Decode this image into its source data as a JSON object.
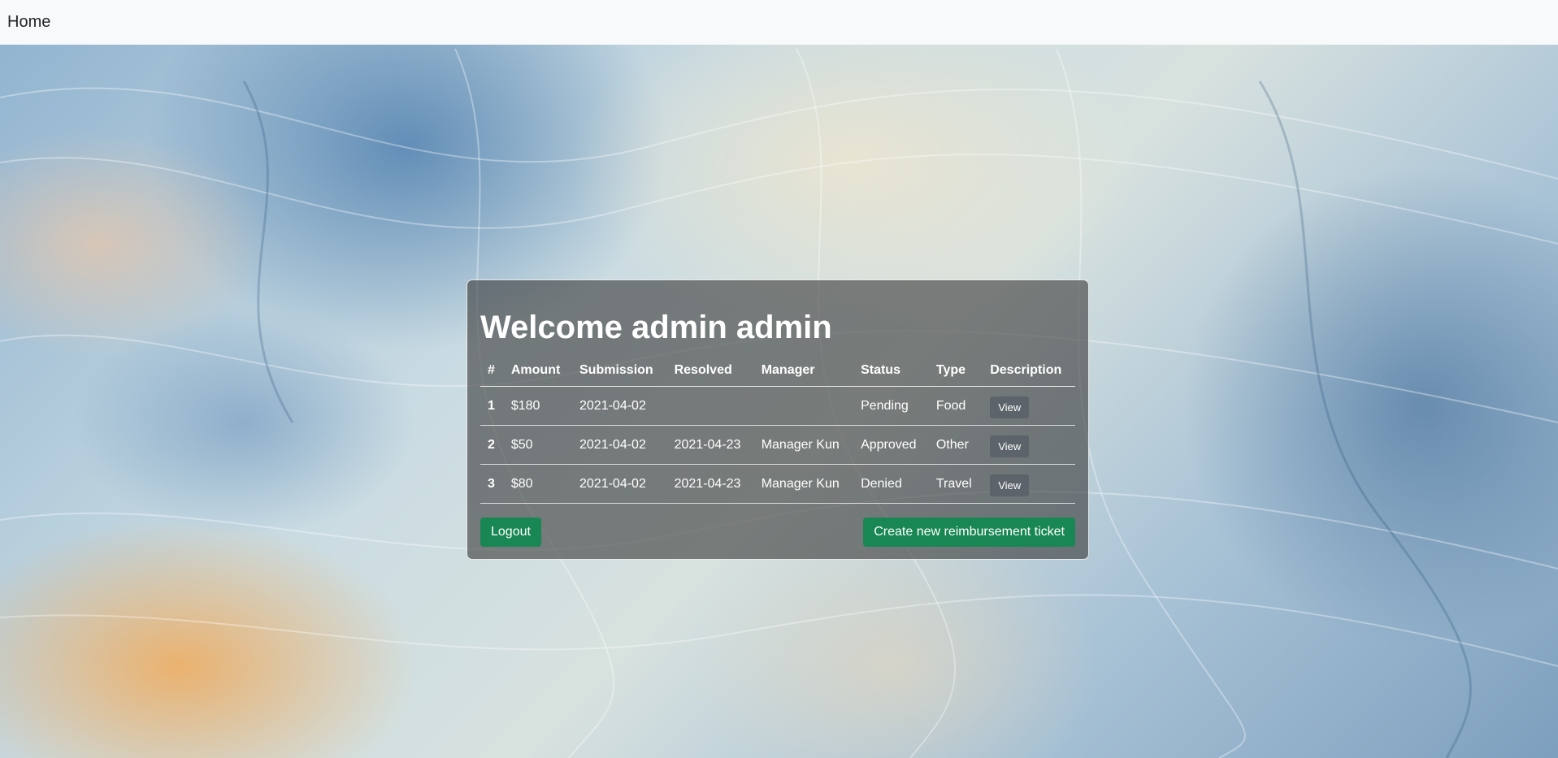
{
  "navbar": {
    "brand": "Home"
  },
  "panel": {
    "title": "Welcome admin admin",
    "columns": [
      "#",
      "Amount",
      "Submission",
      "Resolved",
      "Manager",
      "Status",
      "Type",
      "Description"
    ],
    "rows": [
      {
        "id": "1",
        "amount": "$180",
        "submission": "2021-04-02",
        "resolved": "",
        "manager": "",
        "status": "Pending",
        "type": "Food",
        "action": "View"
      },
      {
        "id": "2",
        "amount": "$50",
        "submission": "2021-04-02",
        "resolved": "2021-04-23",
        "manager": "Manager Kun",
        "status": "Approved",
        "type": "Other",
        "action": "View"
      },
      {
        "id": "3",
        "amount": "$80",
        "submission": "2021-04-02",
        "resolved": "2021-04-23",
        "manager": "Manager Kun",
        "status": "Denied",
        "type": "Travel",
        "action": "View"
      }
    ],
    "logout_label": "Logout",
    "create_label": "Create new reimbursement ticket"
  },
  "colors": {
    "navbar_bg": "#f8f9fa",
    "success": "#198754",
    "secondary": "#5c636a"
  }
}
